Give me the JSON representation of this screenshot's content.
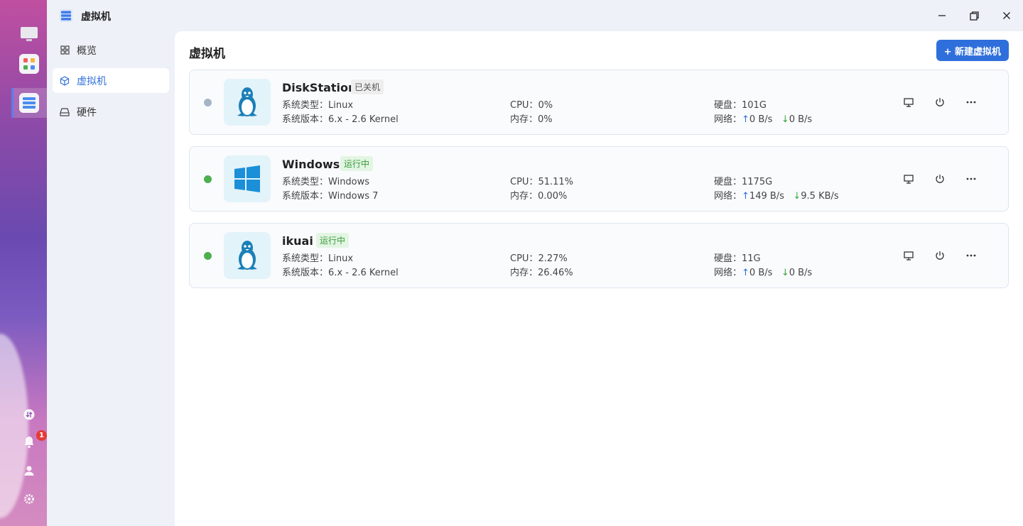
{
  "app": {
    "title": "虚拟机",
    "icon": "server-stack-icon"
  },
  "sidebar": {
    "items": [
      {
        "label": "概览",
        "icon": "grid-icon",
        "active": false
      },
      {
        "label": "虚拟机",
        "icon": "cube-icon",
        "active": true
      },
      {
        "label": "硬件",
        "icon": "hard-drive-icon",
        "active": false
      }
    ]
  },
  "main": {
    "title": "虚拟机",
    "new_button": "+ 新建虚拟机"
  },
  "labels": {
    "type": "系统类型：",
    "version": "系统版本：",
    "cpu": "CPU：",
    "mem": "内存：",
    "disk": "硬盘：",
    "net": "网络："
  },
  "vms": [
    {
      "name": "DiskStation",
      "status": "已关机",
      "running": false,
      "os": "linux",
      "type": "Linux",
      "version": "6.x - 2.6 Kernel",
      "cpu": "0%",
      "mem": "0%",
      "disk": "101G",
      "up": "0 B/s",
      "down": "0 B/s"
    },
    {
      "name": "Windows",
      "status": "运行中",
      "running": true,
      "os": "windows",
      "type": "Windows",
      "version": "Windows 7",
      "cpu": "51.11%",
      "mem": "0.00%",
      "disk": "1175G",
      "up": "149 B/s",
      "down": "9.5 KB/s"
    },
    {
      "name": "ikuai",
      "status": "运行中",
      "running": true,
      "os": "linux",
      "type": "Linux",
      "version": "6.x - 2.6 Kernel",
      "cpu": "2.27%",
      "mem": "26.46%",
      "disk": "11G",
      "up": "0 B/s",
      "down": "0 B/s"
    }
  ],
  "dock": {
    "notification_count": "1"
  },
  "colors": {
    "accent": "#2f6fdc",
    "running": "#4caf50",
    "stopped": "#a7b4c8"
  }
}
